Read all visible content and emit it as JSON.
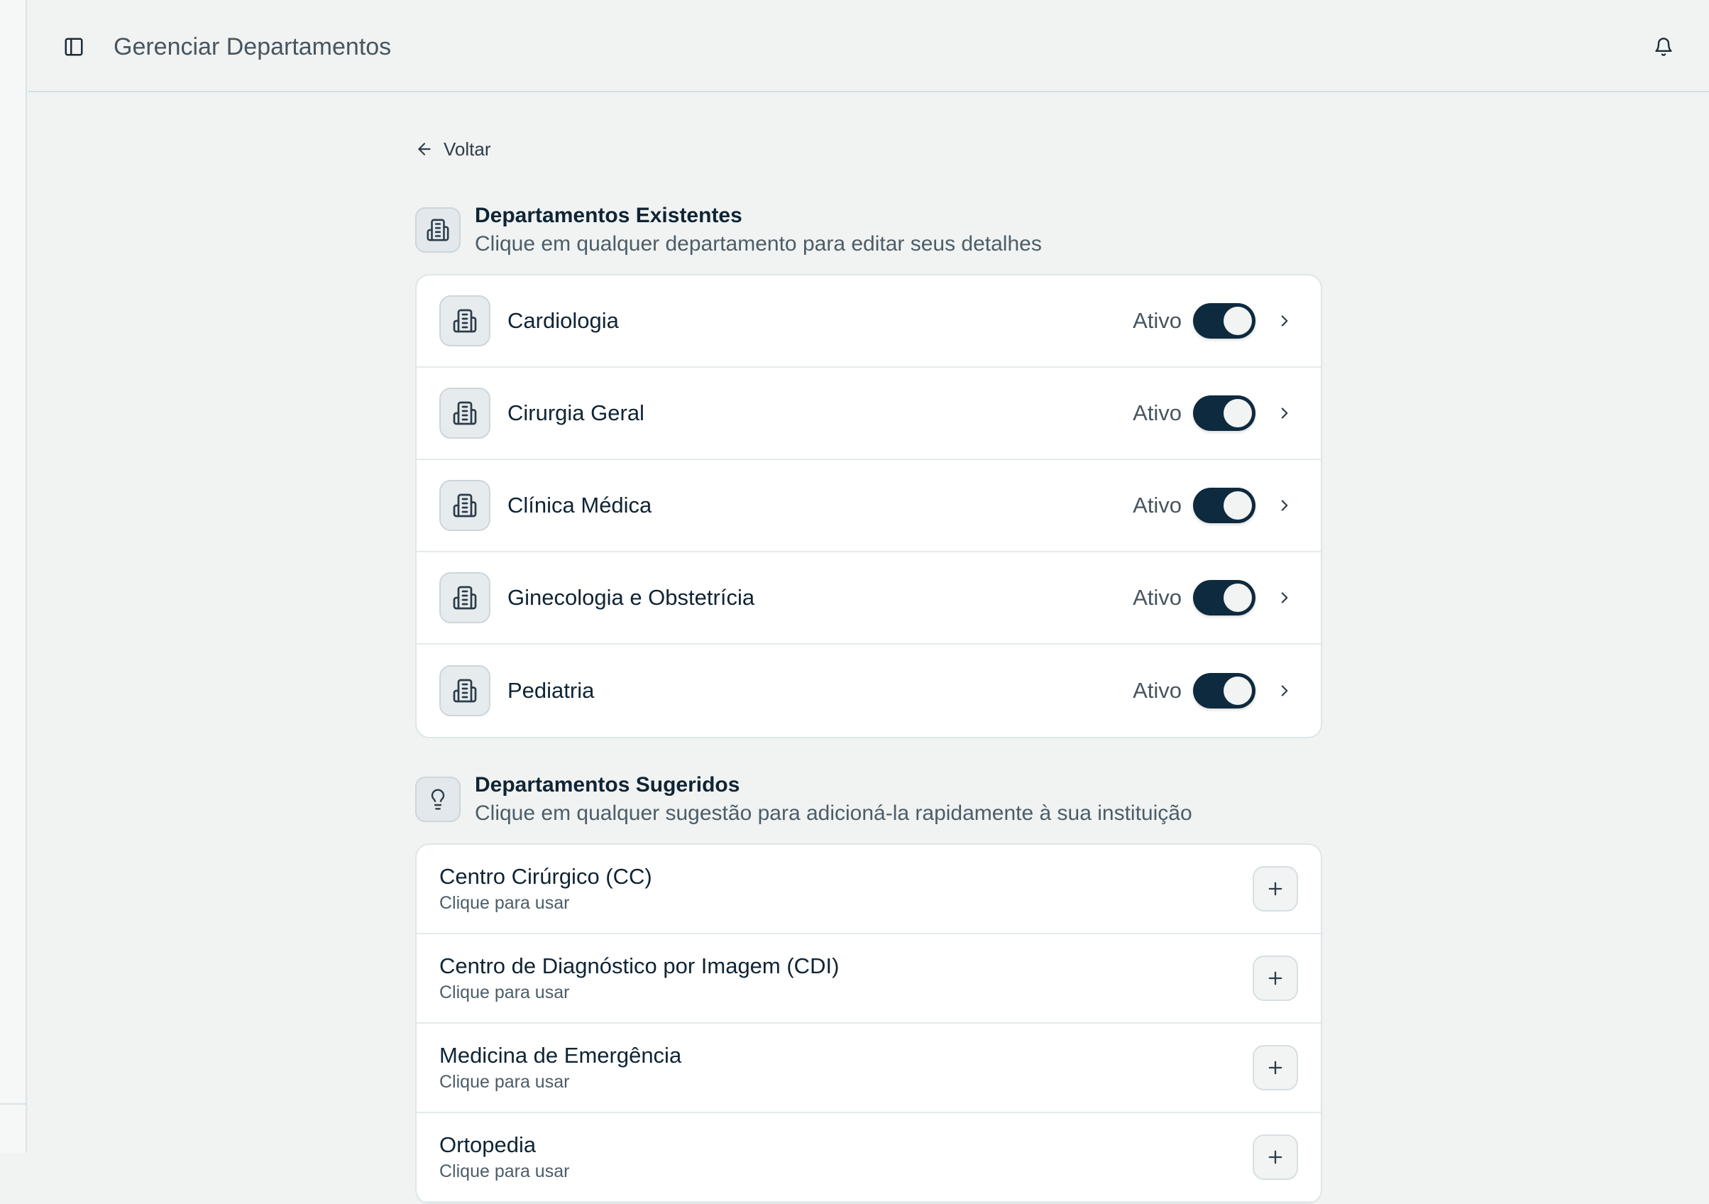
{
  "header": {
    "title": "Gerenciar Departamentos"
  },
  "back": {
    "label": "Voltar"
  },
  "existing": {
    "title": "Departamentos Existentes",
    "subtitle": "Clique em qualquer departamento para editar seus detalhes",
    "items": [
      {
        "name": "Cardiologia",
        "status": "Ativo",
        "active": true
      },
      {
        "name": "Cirurgia Geral",
        "status": "Ativo",
        "active": true
      },
      {
        "name": "Clínica Médica",
        "status": "Ativo",
        "active": true
      },
      {
        "name": "Ginecologia e Obstetrícia",
        "status": "Ativo",
        "active": true
      },
      {
        "name": "Pediatria",
        "status": "Ativo",
        "active": true
      }
    ]
  },
  "suggested": {
    "title": "Departamentos Sugeridos",
    "subtitle": "Clique em qualquer sugestão para adicioná-la rapidamente à sua instituição",
    "items": [
      {
        "name": "Centro Cirúrgico (CC)",
        "hint": "Clique para usar"
      },
      {
        "name": "Centro de Diagnóstico por Imagem (CDI)",
        "hint": "Clique para usar"
      },
      {
        "name": "Medicina de Emergência",
        "hint": "Clique para usar"
      },
      {
        "name": "Ortopedia",
        "hint": "Clique para usar"
      }
    ]
  },
  "icons": {
    "sidebar_toggle": "panel-left-icon",
    "bell": "bell-icon",
    "back": "arrow-left-icon",
    "department": "building-icon",
    "suggested": "lightbulb-icon",
    "chevron": "chevron-right-icon",
    "add": "plus-icon"
  },
  "colors": {
    "toggle_on": "#0e2a3f",
    "background": "#f0f3f2",
    "card": "#ffffff"
  }
}
